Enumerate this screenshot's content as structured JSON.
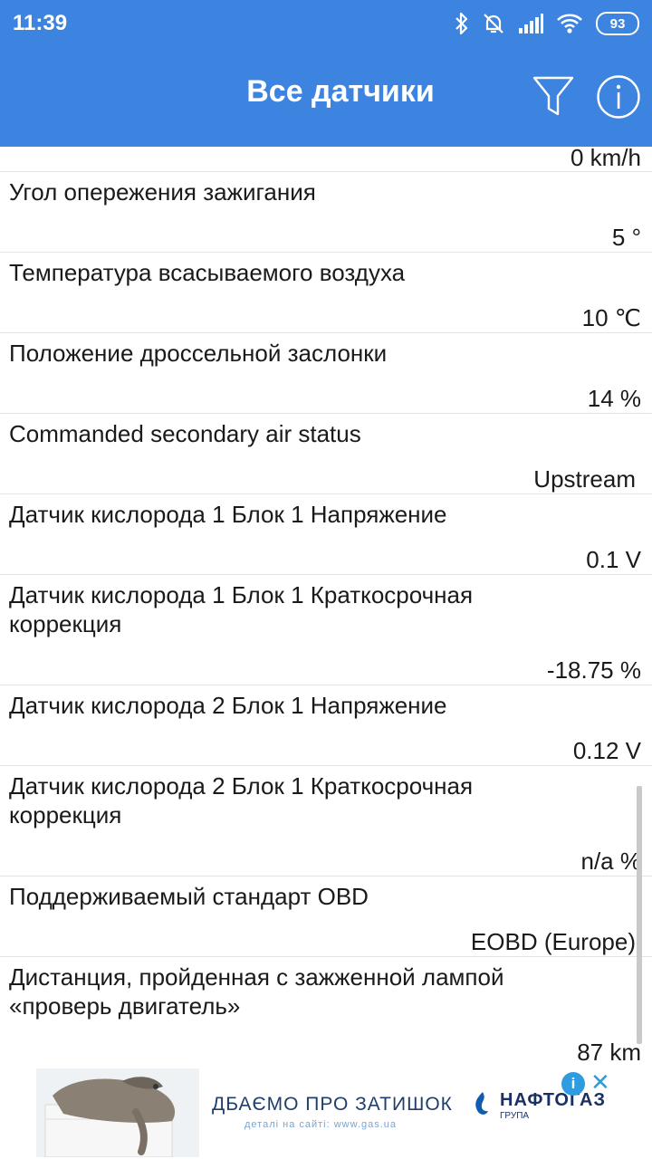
{
  "status_bar": {
    "time": "11:39",
    "battery": "93",
    "icons": [
      "bluetooth-icon",
      "alarm-off-icon",
      "signal-icon",
      "wifi-icon",
      "battery-icon"
    ]
  },
  "app_bar": {
    "title": "Все датчики",
    "filter_icon": "filter-icon",
    "info_icon": "info-icon",
    "background_color": "#3d84e0"
  },
  "sensors": [
    {
      "label": "",
      "value": "0 km/h"
    },
    {
      "label": "Угол опережения зажигания",
      "value": "5 °"
    },
    {
      "label": "Температура всасываемого воздуха",
      "value": "10 ℃"
    },
    {
      "label": "Положение дроссельной заслонки",
      "value": "14 %"
    },
    {
      "label": "Commanded secondary air status",
      "value": "Upstream"
    },
    {
      "label": "Датчик кислорода 1 Блок 1 Напряжение",
      "value": "0.1 V"
    },
    {
      "label": "Датчик кислорода 1 Блок 1 Краткосрочная коррекция",
      "value": "-18.75 %"
    },
    {
      "label": "Датчик кислорода 2 Блок 1 Напряжение",
      "value": "0.12 V"
    },
    {
      "label": "Датчик кислорода 2 Блок 1 Краткосрочная коррекция",
      "value": "n/a %"
    },
    {
      "label": "Поддерживаемый стандарт OBD",
      "value": "EOBD (Europe)"
    },
    {
      "label": "Дистанция, пройденная с зажженной лампой «проверь двигатель»",
      "value": "87 km"
    }
  ],
  "ad": {
    "headline": "ДБАЄМО ПРО ЗАТИШОК",
    "subline": "деталі на сайті: www.gas.ua",
    "brand": "НАФТОГАЗ",
    "brand_sub": "ГРУПА",
    "info_label": "i",
    "close_label": "✕"
  }
}
